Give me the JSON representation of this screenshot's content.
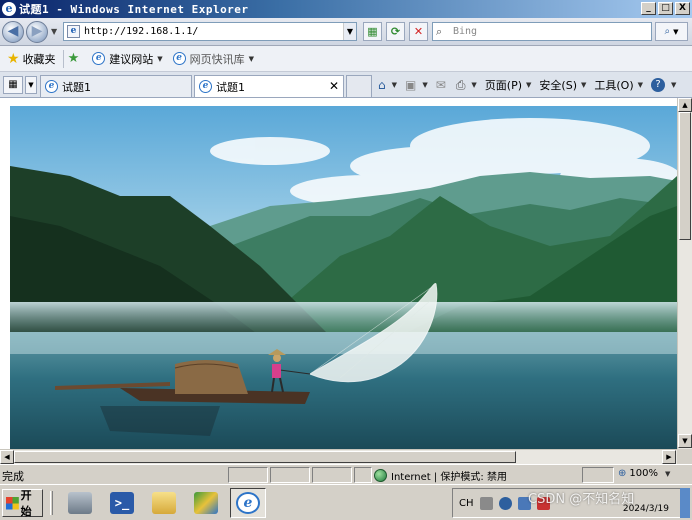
{
  "window": {
    "title": "试题1 - Windows Internet Explorer",
    "controls": [
      "_",
      "□",
      "X"
    ]
  },
  "address_bar": {
    "url": "http://192.168.1.1/",
    "search_placeholder": "Bing"
  },
  "favorites_bar": {
    "favorites_label": "收藏夹",
    "items": [
      {
        "label": "建议网站",
        "icon": "ie-page-icon"
      },
      {
        "label": "网页快讯库",
        "icon": "ie-page-icon"
      }
    ]
  },
  "tabs": [
    {
      "title": "试题1",
      "active": false
    },
    {
      "title": "试题1",
      "active": true
    }
  ],
  "command_bar": {
    "page_label": "页面(P)",
    "safety_label": "安全(S)",
    "tools_label": "工具(O)"
  },
  "content": {
    "image_subject": "fisherman-casting-net-on-misty-mountain-lake"
  },
  "status_bar": {
    "status_text": "完成",
    "zone_text": "Internet | 保护模式: 禁用",
    "zoom_text": "100%"
  },
  "taskbar": {
    "start_label": "开始",
    "apps": [
      "server-manager-icon",
      "powershell-icon",
      "explorer-folder-icon",
      "network-icon",
      "internet-explorer-icon"
    ],
    "tray": {
      "language": "CH",
      "clock_date": "2024/3/19"
    }
  },
  "watermark": "CSDN @不知名知",
  "colors": {
    "title_bar": "#0a246a",
    "link_blue": "#2d74c8",
    "chrome_gray": "#d4d0c8"
  }
}
